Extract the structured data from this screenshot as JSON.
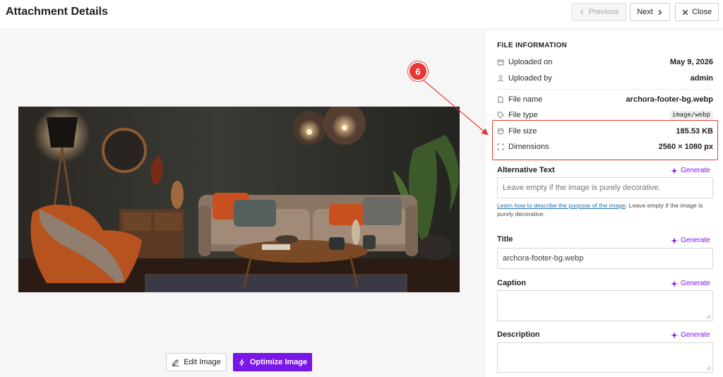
{
  "header": {
    "title": "Attachment Details",
    "previous_label": "Previous",
    "next_label": "Next",
    "close_label": "Close"
  },
  "image_actions": {
    "edit_label": "Edit Image",
    "optimize_label": "Optimize Image"
  },
  "file_info": {
    "section_title": "FILE INFORMATION",
    "uploaded_on": {
      "label": "Uploaded on",
      "value": "May 9, 2026"
    },
    "uploaded_by": {
      "label": "Uploaded by",
      "value": "admin"
    },
    "file_name": {
      "label": "File name",
      "value": "archora-footer-bg.webp"
    },
    "file_type": {
      "label": "File type",
      "value": "image/webp"
    },
    "file_size": {
      "label": "File size",
      "value": "185.53 KB"
    },
    "dimensions": {
      "label": "Dimensions",
      "value": "2560 × 1080 px"
    }
  },
  "fields": {
    "generate_label": "Generate",
    "alt_text": {
      "label": "Alternative Text",
      "placeholder": "Leave empty if the image is purely decorative.",
      "help_link": "Learn how to describe the purpose of the image",
      "help_text": ". Leave empty if the image is purely decorative."
    },
    "title": {
      "label": "Title",
      "value": "archora-footer-bg.webp"
    },
    "caption": {
      "label": "Caption",
      "value": ""
    },
    "description": {
      "label": "Description",
      "value": ""
    }
  },
  "annotation": {
    "step_number": "6",
    "color": "#e53935"
  },
  "colors": {
    "accent": "#7a17e8",
    "link": "#2271b1"
  }
}
